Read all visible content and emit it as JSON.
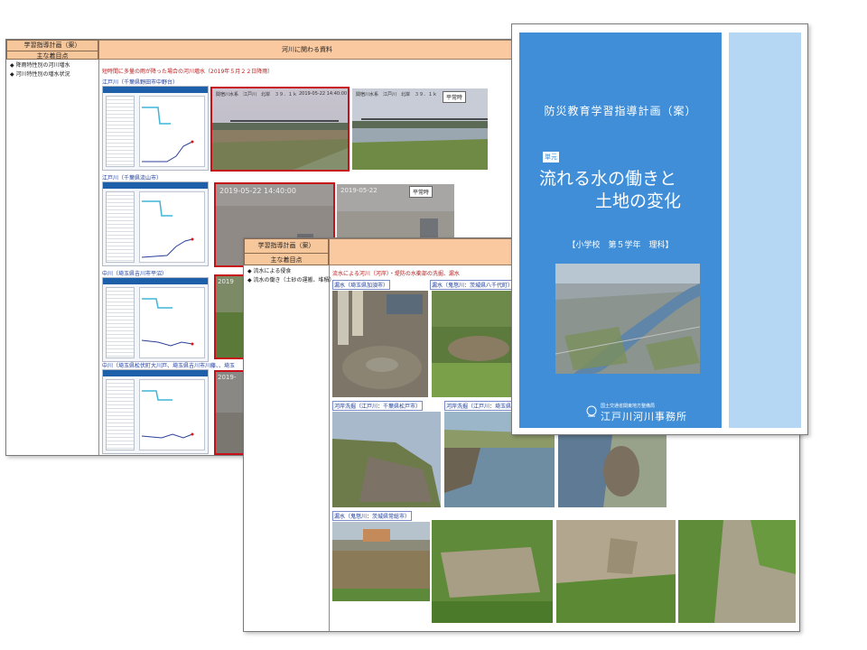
{
  "doc1": {
    "header_left": "学習指導計画（案）",
    "subheader_left": "主な着目点",
    "header_right": "河川に関わる資料",
    "left_items": [
      "◆ 降雨特性別の河川増水",
      "◆ 河川特性別の増水状況"
    ],
    "section_title": "短時間に多量の雨が降った場合の河川増水（2019年５月２２日降雨）",
    "locations": [
      "江戸川（千葉県野田市中野台）",
      "江戸川（千葉県流山市）",
      "中川（埼玉県吉川市平沼）",
      "中川（埼玉県松伏町大川戸、埼玉県吉川市川藤、、埼玉"
    ],
    "photo_caption_1": "関宿川水系　江戸川　北岸　３９．１ｋ",
    "photo_caption_2": "関宿川水系　江戸川　北岸　３９．１ｋ",
    "normal_label": "平常時",
    "timestamp_1": "2019-05-22 14:40:00",
    "timestamp_2": "2019-05-22 14:40:00",
    "timestamp_3": "2019-05-22",
    "timestamp_4": "2019-",
    "timestamp_5": "2019"
  },
  "doc2": {
    "header_left": "学習指導計画（案）",
    "subheader_left": "主な着目点",
    "left_items": [
      "◆ 流水による侵食",
      "◆ 流水の働き（土砂の運搬、堆積）"
    ],
    "section_title": "流水による河川（河岸）・堤防の水衝部の洗掘、漏水",
    "labels": {
      "leak_1": "漏水（埼玉県加須市）",
      "leak_2": "漏水（鬼怒川：茨城県八千代町）",
      "scour_1": "河岸洗掘（江戸川：千葉県松戸市）",
      "scour_2": "河岸洗掘（江戸川：埼玉県三",
      "leak_3": "漏水（鬼怒川：茨城県常総市）"
    }
  },
  "cover": {
    "title": "防災教育学習指導計画（案）",
    "unit_tag": "単元",
    "main_line_1": "流れる水の働きと",
    "main_line_2": "土地の変化",
    "grade": "【小学校　第５学年　理科】",
    "org_line_1": "国土交通省関東地方整備局",
    "org_line_2": "江戸川河川事務所"
  },
  "colors": {
    "header_orange": "#fac9a0",
    "cover_blue": "#3f8ed7",
    "cover_strip": "#b6d7f3",
    "red_frame": "#c8101a",
    "location_blue": "#1a3a9a"
  }
}
